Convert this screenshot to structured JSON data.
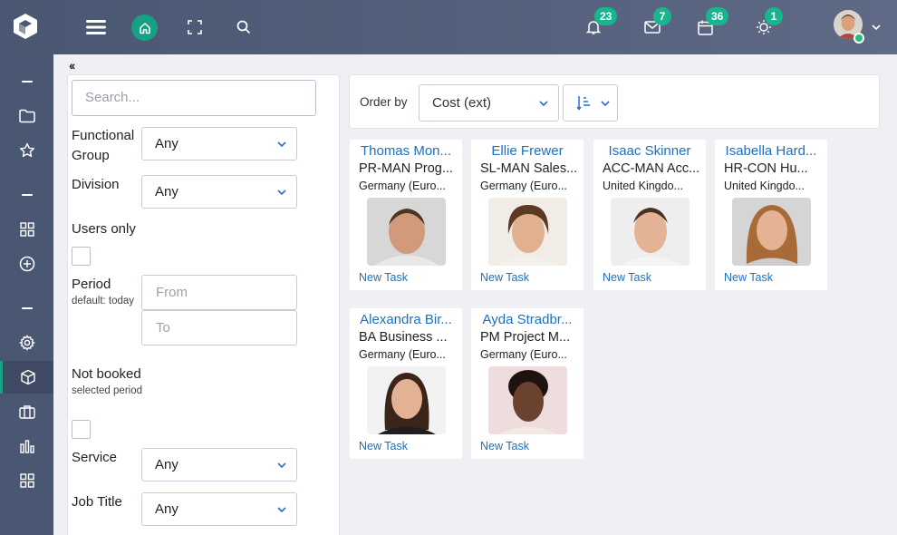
{
  "topbar": {
    "badges": {
      "notifications": "23",
      "messages": "7",
      "calendar": "36",
      "tips": "1"
    }
  },
  "filters": {
    "search_placeholder": "Search...",
    "functional_group_label": "Functional Group",
    "functional_group_value": "Any",
    "division_label": "Division",
    "division_value": "Any",
    "users_only_label": "Users only",
    "period_label": "Period",
    "period_sub": "default: today",
    "from_placeholder": "From",
    "to_placeholder": "To",
    "not_booked_label": "Not booked",
    "not_booked_sub": "selected period",
    "service_label": "Service",
    "service_value": "Any",
    "job_title_label": "Job Title",
    "job_title_value": "Any"
  },
  "order": {
    "label": "Order by",
    "value": "Cost (ext)"
  },
  "cards": [
    {
      "name": "Thomas Mon...",
      "role": "PR-MAN Prog...",
      "location": "Germany (Euro...",
      "task": "New Task"
    },
    {
      "name": "Ellie Frewer",
      "role": "SL-MAN Sales...",
      "location": "Germany (Euro...",
      "task": "New Task"
    },
    {
      "name": "Isaac Skinner",
      "role": "ACC-MAN Acc...",
      "location": "United Kingdo...",
      "task": "New Task"
    },
    {
      "name": "Isabella Hard...",
      "role": "HR-CON Hu...",
      "location": "United Kingdo...",
      "task": "New Task"
    },
    {
      "name": "Alexandra Bir...",
      "role": "BA Business ...",
      "location": "Germany (Euro...",
      "task": "New Task"
    },
    {
      "name": "Ayda Stradbr...",
      "role": "PM Project M...",
      "location": "Germany (Euro...",
      "task": "New Task"
    }
  ]
}
